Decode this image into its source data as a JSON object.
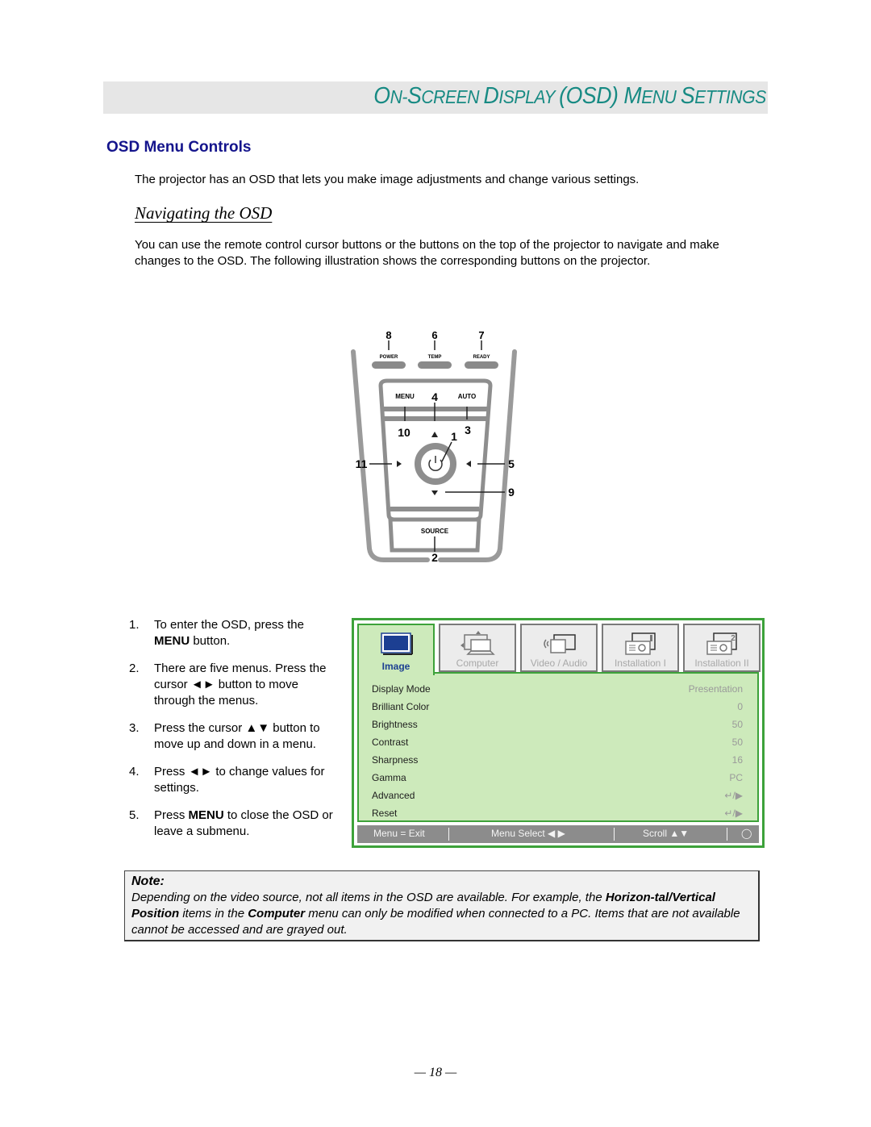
{
  "header": {
    "title_parts": [
      {
        "big": "O",
        "small": "N-"
      },
      {
        "big": "S",
        "small": "CREEN "
      },
      {
        "big": "D",
        "small": "ISPLAY "
      },
      {
        "big": "(OSD) ",
        "small": ""
      },
      {
        "big": "M",
        "small": "ENU "
      },
      {
        "big": "S",
        "small": "ETTINGS"
      }
    ],
    "title_full": "ON-SCREEN DISPLAY (OSD) MENU SETTINGS"
  },
  "section": {
    "heading": "OSD Menu Controls",
    "intro": "The projector has an OSD that lets you make image adjustments and change various settings."
  },
  "navigating": {
    "heading": "Navigating the OSD",
    "body": "You can use the remote control cursor buttons or the buttons on the top of the projector to navigate and make changes to the OSD. The following illustration shows the corresponding buttons on the projector."
  },
  "keypad": {
    "indicators": [
      {
        "number": "8",
        "label": "POWER"
      },
      {
        "number": "6",
        "label": "TEMP"
      },
      {
        "number": "7",
        "label": "READY"
      }
    ],
    "menu_label": "MENU",
    "auto_label": "AUTO",
    "source_label": "SOURCE",
    "callouts": [
      "1",
      "2",
      "3",
      "4",
      "5",
      "9",
      "10",
      "11"
    ]
  },
  "steps": [
    {
      "num": "1.",
      "pre": "To enter the OSD, press the ",
      "bold": "MENU",
      "post": " button."
    },
    {
      "num": "2.",
      "pre": "There are five menus. Press the cursor ◄► button to move through the menus.",
      "bold": "",
      "post": ""
    },
    {
      "num": "3.",
      "pre": "Press the cursor ▲▼ button to move up and down in a menu.",
      "bold": "",
      "post": ""
    },
    {
      "num": "4.",
      "pre": "Press ◄► to change values for settings.",
      "bold": "",
      "post": ""
    },
    {
      "num": "5.",
      "pre": "Press ",
      "bold": "MENU",
      "post": " to close the OSD or leave a submenu."
    }
  ],
  "osd": {
    "tabs": [
      {
        "label": "Image",
        "icon": "image-icon",
        "active": true
      },
      {
        "label": "Computer",
        "icon": "computer-icon",
        "active": false
      },
      {
        "label": "Video / Audio",
        "icon": "video-audio-icon",
        "active": false
      },
      {
        "label": "Installation I",
        "icon": "installation-1-icon",
        "active": false
      },
      {
        "label": "Installation II",
        "icon": "installation-2-icon",
        "active": false
      }
    ],
    "rows": [
      {
        "label": "Display Mode",
        "value": "Presentation"
      },
      {
        "label": "Brilliant Color",
        "value": "0"
      },
      {
        "label": "Brightness",
        "value": "50"
      },
      {
        "label": "Contrast",
        "value": "50"
      },
      {
        "label": "Sharpness",
        "value": "16"
      },
      {
        "label": "Gamma",
        "value": "PC"
      },
      {
        "label": "Advanced",
        "value": "↵/▶"
      },
      {
        "label": "Reset",
        "value": "↵/▶"
      }
    ],
    "footer": {
      "exit": "Menu = Exit",
      "select": "Menu Select ◀ ▶",
      "scroll": "Scroll ▲▼",
      "icon": "lamp-icon"
    },
    "colors": {
      "border": "#3da23a",
      "panel": "#cdeabb",
      "active_label": "#1c3f92"
    }
  },
  "note": {
    "title": "Note:",
    "text_1": "Depending on the video source, not all items in the OSD are available. For example, the ",
    "bold_1": "Horizon-tal/Vertical Position",
    "text_2": " items in the ",
    "bold_2": "Computer",
    "text_3": " menu can only be modified when connected to a PC. Items that are not available cannot be accessed and are grayed out."
  },
  "footer": {
    "page_number": "— 18 —"
  }
}
